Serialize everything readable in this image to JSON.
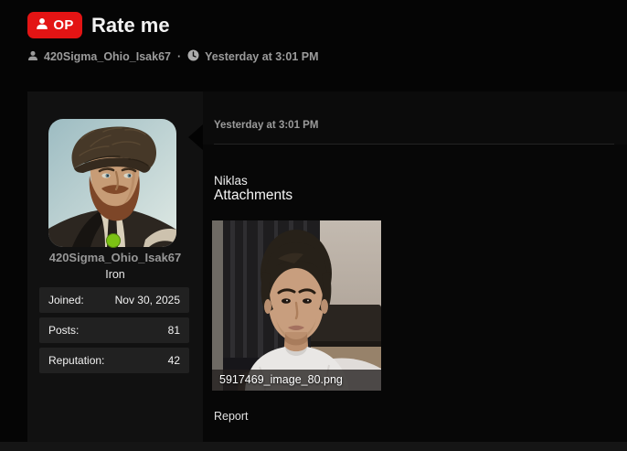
{
  "colors": {
    "op_badge_red": "#e31414",
    "status_online_green": "#7cc214",
    "page_background": "#050505"
  },
  "thread_header": {
    "op_badge_label": "OP",
    "title": "Rate me",
    "author": "420Sigma_Ohio_Isak67",
    "separator": "·",
    "timestamp": "Yesterday at 3:01 PM"
  },
  "author_panel": {
    "username": "420Sigma_Ohio_Isak67",
    "rank": "Iron",
    "status": "online",
    "stats": [
      {
        "label": "Joined:",
        "value": "Nov 30, 2025"
      },
      {
        "label": "Posts:",
        "value": "81"
      },
      {
        "label": "Reputation:",
        "value": "42"
      }
    ]
  },
  "post": {
    "timestamp": "Yesterday at 3:01 PM",
    "body": "Niklas",
    "attachments_heading": "Attachments",
    "attachment_filename": "5917469_image_80.png",
    "report_label": "Report"
  }
}
